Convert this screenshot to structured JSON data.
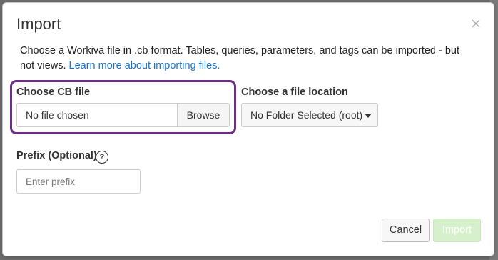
{
  "dialog": {
    "title": "Import",
    "description": "Choose a Workiva file in .cb format. Tables, queries, parameters, and tags can be imported - but not views.",
    "learn_more_link": "Learn more about importing files."
  },
  "cb_file": {
    "label": "Choose CB file",
    "value": "No file chosen",
    "browse_label": "Browse"
  },
  "location": {
    "label": "Choose a file location",
    "selected": "No Folder Selected (root)"
  },
  "prefix": {
    "label": "Prefix (Optional)",
    "placeholder": "Enter prefix",
    "help_glyph": "?"
  },
  "footer": {
    "cancel_label": "Cancel",
    "import_label": "Import"
  },
  "colors": {
    "accent_outline": "#6b2d86",
    "link": "#1a73c9",
    "import_disabled": "#d6f0cc"
  },
  "icons": {
    "close": "close-icon",
    "dropdown": "chevron-down-icon",
    "help": "help-icon"
  }
}
